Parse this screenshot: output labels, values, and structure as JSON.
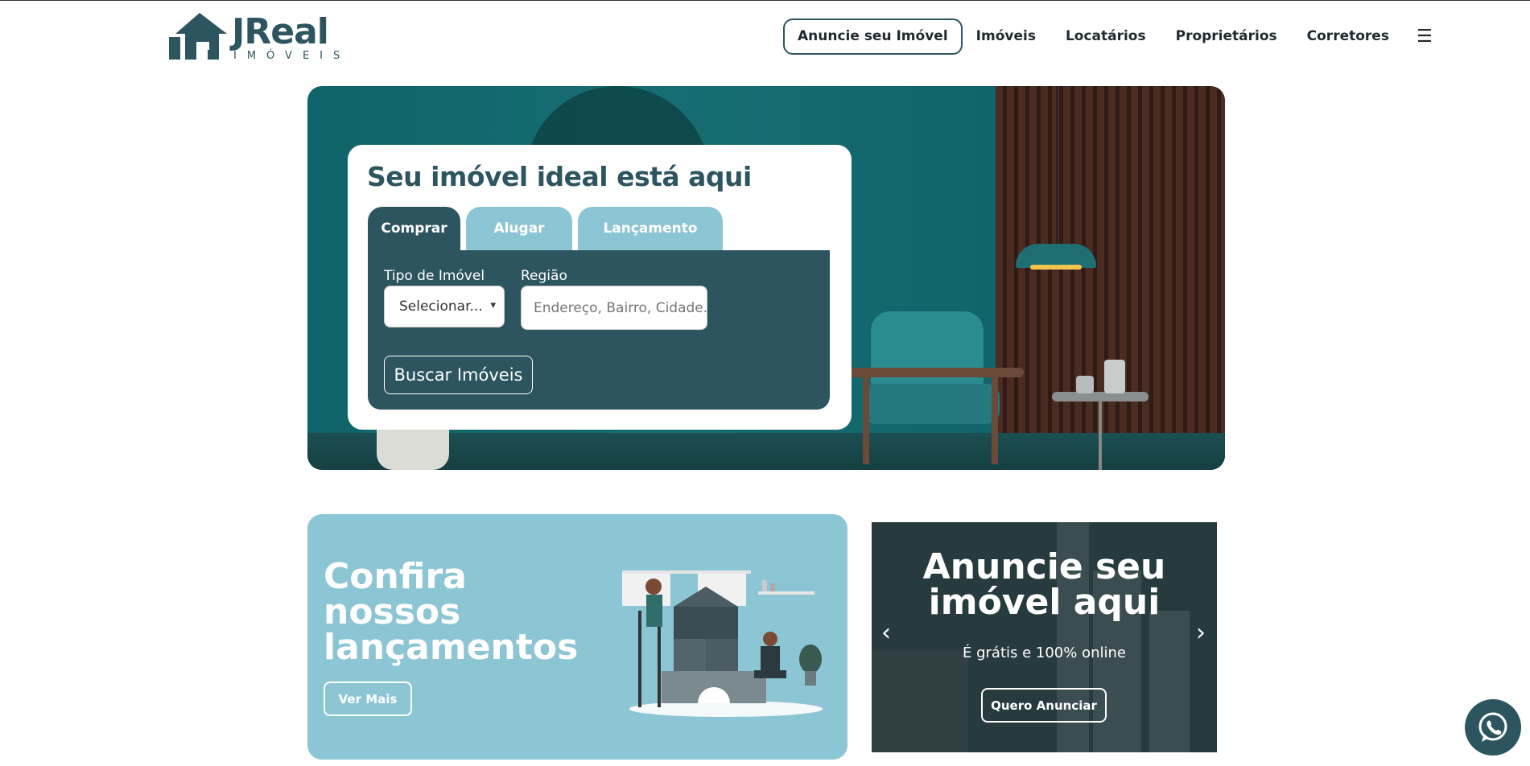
{
  "brand": {
    "name": "JReal",
    "sub": "IMÓVEIS",
    "color": "#2d5560"
  },
  "nav": {
    "cta": "Anuncie seu Imóvel",
    "links": [
      "Imóveis",
      "Locatários",
      "Proprietários",
      "Corretores"
    ],
    "menu_icon": "hamburger-icon"
  },
  "search": {
    "title": "Seu imóvel ideal está aqui",
    "tabs": [
      "Comprar",
      "Alugar",
      "Lançamento"
    ],
    "active_tab": "Comprar",
    "type_label": "Tipo de Imóvel",
    "type_value": "Selecionar...",
    "region_label": "Região",
    "region_placeholder": "Endereço, Bairro, Cidade...",
    "button": "Buscar Imóveis"
  },
  "launch": {
    "title": "Confira nossos lançamentos",
    "button": "Ver Mais",
    "bg": "#8cc6d4"
  },
  "ad": {
    "title": "Anuncie seu imóvel aqui",
    "subtitle": "É grátis e 100% online",
    "button": "Quero Anunciar"
  },
  "whatsapp": {
    "icon": "whatsapp-icon"
  }
}
